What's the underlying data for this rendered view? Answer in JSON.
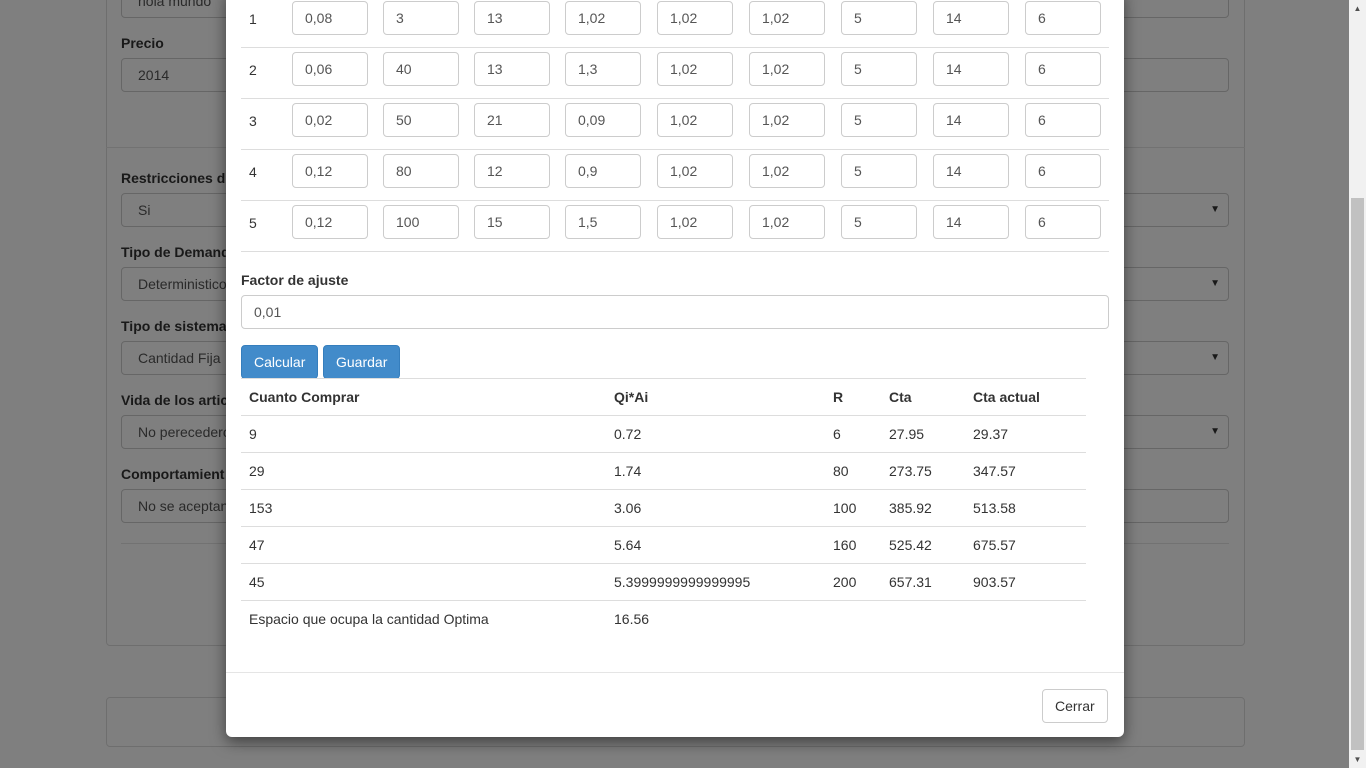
{
  "background": {
    "name_value": "hola mundo",
    "price_label": "Precio",
    "price_value": "2014",
    "restrictions_label": "Restricciones d",
    "restrictions_value": "Si",
    "demand_type_label": "Tipo de Demand",
    "demand_type_value": "Deterministico",
    "system_type_label": "Tipo de sistema",
    "system_type_value": "Cantidad Fija",
    "article_life_label": "Vida de los artic",
    "article_life_value": "No perecedero",
    "behavior_label": "Comportamient",
    "behavior_value": "No se aceptan"
  },
  "grid": {
    "rows": [
      {
        "num": "1",
        "cells": [
          "0,08",
          "3",
          "13",
          "1,02",
          "1,02",
          "1,02",
          "5",
          "14",
          "6"
        ]
      },
      {
        "num": "2",
        "cells": [
          "0,06",
          "40",
          "13",
          "1,3",
          "1,02",
          "1,02",
          "5",
          "14",
          "6"
        ]
      },
      {
        "num": "3",
        "cells": [
          "0,02",
          "50",
          "21",
          "0,09",
          "1,02",
          "1,02",
          "5",
          "14",
          "6"
        ]
      },
      {
        "num": "4",
        "cells": [
          "0,12",
          "80",
          "12",
          "0,9",
          "1,02",
          "1,02",
          "5",
          "14",
          "6"
        ]
      },
      {
        "num": "5",
        "cells": [
          "0,12",
          "100",
          "15",
          "1,5",
          "1,02",
          "1,02",
          "5",
          "14",
          "6"
        ]
      }
    ]
  },
  "factor": {
    "label": "Factor de ajuste",
    "value": "0,01"
  },
  "buttons": {
    "calcular": "Calcular",
    "guardar": "Guardar",
    "cerrar": "Cerrar"
  },
  "results": {
    "headers": [
      "Cuanto Comprar",
      "Qi*Ai",
      "R",
      "Cta",
      "Cta actual"
    ],
    "rows": [
      [
        "9",
        "0.72",
        "6",
        "27.95",
        "29.37"
      ],
      [
        "29",
        "1.74",
        "80",
        "273.75",
        "347.57"
      ],
      [
        "153",
        "3.06",
        "100",
        "385.92",
        "513.58"
      ],
      [
        "47",
        "5.64",
        "160",
        "525.42",
        "675.57"
      ],
      [
        "45",
        "5.3999999999999995",
        "200",
        "657.31",
        "903.57"
      ]
    ],
    "footer_label": "Espacio que ocupa la cantidad Optima",
    "footer_value": "16.56"
  },
  "colors": {
    "primary": "#428bca",
    "backdrop": "rgba(0,0,0,0.5)"
  }
}
